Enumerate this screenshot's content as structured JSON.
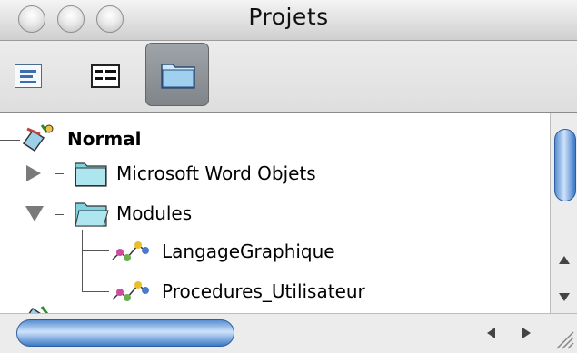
{
  "window": {
    "title": "Projets"
  },
  "toolbar": {
    "buttons": [
      {
        "icon": "properties-view-icon",
        "selected": false
      },
      {
        "icon": "object-view-icon",
        "selected": false
      },
      {
        "icon": "folder-toggle-icon",
        "selected": true
      }
    ]
  },
  "tree": {
    "items": [
      {
        "label": "Normal",
        "bold": true,
        "icon": "project-icon"
      },
      {
        "label": "Microsoft Word Objets",
        "icon": "folder-icon",
        "expanded": false
      },
      {
        "label": "Modules",
        "icon": "open-folder-icon",
        "expanded": true
      },
      {
        "label": "LangageGraphique",
        "icon": "module-icon"
      },
      {
        "label": "Procedures_Utilisateur",
        "icon": "module-icon"
      }
    ]
  },
  "colors": {
    "scroll_accent": "#3c79c6",
    "folder": "#7fd3e0"
  }
}
